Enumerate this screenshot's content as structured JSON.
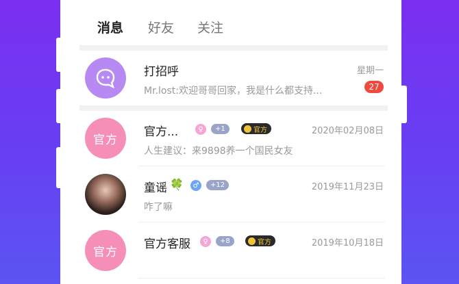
{
  "tabs": [
    {
      "label": "消息",
      "active": true
    },
    {
      "label": "好友",
      "active": false
    },
    {
      "label": "关注",
      "active": false
    }
  ],
  "conversations": [
    {
      "name": "打招呼",
      "preview": "Mr.lost:欢迎哥哥回家，我是什么都支持...",
      "time": "星期一",
      "unread": "27",
      "avatar_icon": "chat-bubble-icon"
    },
    {
      "name": "官方...",
      "preview": "人生建议：来9898养一个国民女友",
      "time": "2020年02月08日",
      "avatar_text": "官方",
      "gender": "female",
      "level": "+1",
      "official_label": "官方"
    },
    {
      "name": "童谣",
      "emoji": "🍀",
      "preview": "咋了嘛",
      "time": "2019年11月23日",
      "gender": "male",
      "level": "+12"
    },
    {
      "name": "官方客服",
      "preview": "",
      "time": "2019年10月18日",
      "avatar_text": "官方",
      "gender": "female",
      "level": "+8",
      "official_label": "官方"
    }
  ],
  "colors": {
    "background_top": "#7b2ff0",
    "background_bottom": "#5b54f3",
    "unread_badge": "#f04a3f",
    "greet_avatar": "#b68af2",
    "official_avatar": "#f58fb8"
  }
}
